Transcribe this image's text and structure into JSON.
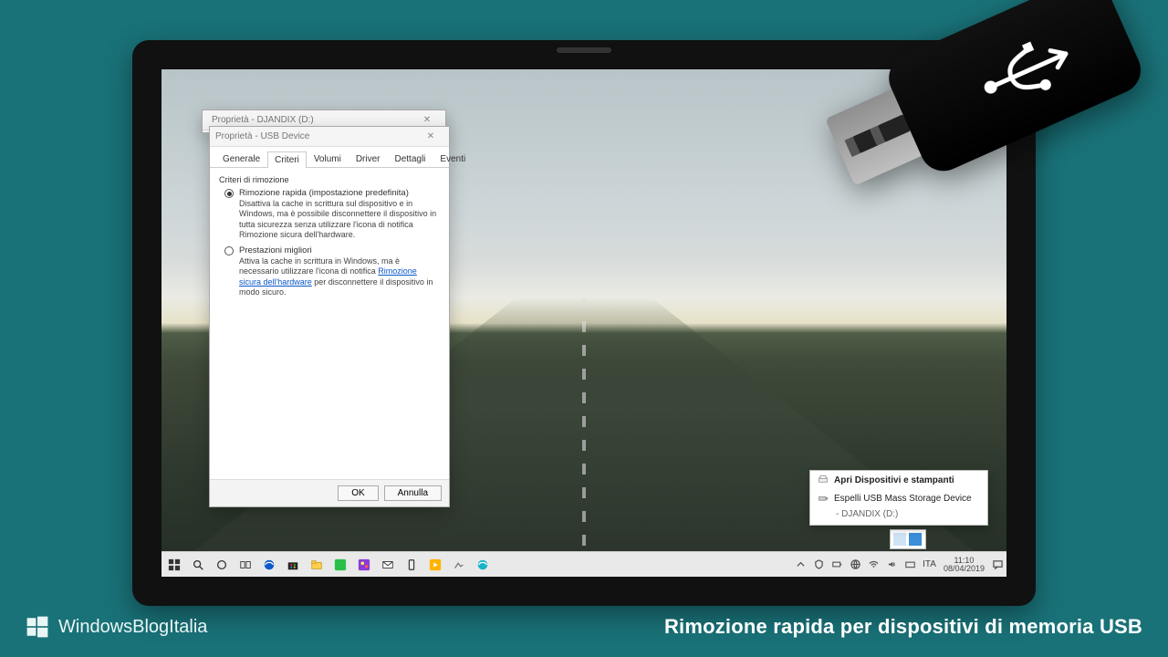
{
  "brand": {
    "name": "WindowsBlogItalia"
  },
  "caption": "Rimozione rapida per dispositivi di memoria USB",
  "dialog_back": {
    "title": "Proprietà - DJANDIX (D:)"
  },
  "dialog_front": {
    "title": "Proprietà - USB Device",
    "tabs": [
      "Generale",
      "Criteri",
      "Volumi",
      "Driver",
      "Dettagli",
      "Eventi"
    ],
    "active_tab_index": 1,
    "group_title": "Criteri di rimozione",
    "opt1": {
      "label": "Rimozione rapida (impostazione predefinita)",
      "desc": "Disattiva la cache in scrittura sul dispositivo e in Windows, ma è possibile disconnettere il dispositivo in tutta sicurezza senza utilizzare l'icona di notifica Rimozione sicura dell'hardware."
    },
    "opt2": {
      "label": "Prestazioni migliori",
      "desc_pre": "Attiva la cache in scrittura in Windows, ma è necessario utilizzare l'icona di notifica ",
      "link": "Rimozione sicura dell'hardware",
      "desc_post": " per disconnettere il dispositivo in modo sicuro."
    },
    "buttons": {
      "ok": "OK",
      "cancel": "Annulla"
    }
  },
  "tray_popup": {
    "line1": "Apri Dispositivi e stampanti",
    "line2": "Espelli USB Mass Storage Device",
    "line3": "-   DJANDIX (D:)"
  },
  "taskbar": {
    "lang": "ITA",
    "time": "11:10",
    "date": "08/04/2019"
  }
}
